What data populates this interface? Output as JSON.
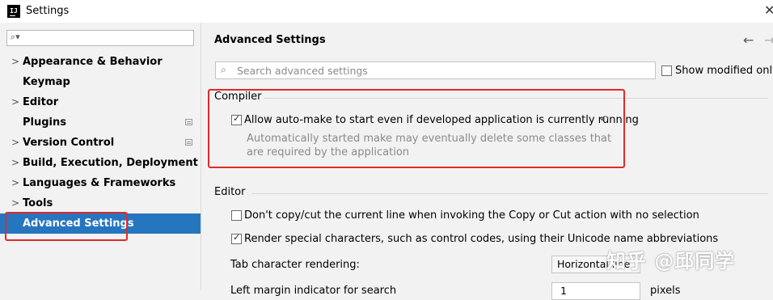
{
  "window": {
    "title": "Settings"
  },
  "sidebar": {
    "search_placeholder": "",
    "items": [
      {
        "label": "Appearance & Behavior",
        "chevron": true,
        "page_icon": false
      },
      {
        "label": "Keymap",
        "chevron": false,
        "page_icon": false
      },
      {
        "label": "Editor",
        "chevron": true,
        "page_icon": false
      },
      {
        "label": "Plugins",
        "chevron": false,
        "page_icon": true
      },
      {
        "label": "Version Control",
        "chevron": true,
        "page_icon": true
      },
      {
        "label": "Build, Execution, Deployment",
        "chevron": true,
        "page_icon": false
      },
      {
        "label": "Languages & Frameworks",
        "chevron": true,
        "page_icon": false
      },
      {
        "label": "Tools",
        "chevron": true,
        "page_icon": false
      },
      {
        "label": "Advanced Settings",
        "chevron": false,
        "page_icon": false,
        "selected": true
      }
    ]
  },
  "main": {
    "heading": "Advanced Settings",
    "search": {
      "placeholder": "Search advanced settings",
      "value": ""
    },
    "show_modified_only": {
      "label": "Show modified only",
      "checked": false
    },
    "compiler": {
      "title": "Compiler",
      "auto_make": {
        "label": "Allow auto-make to start even if developed application is currently running",
        "checked": true,
        "desc_line1": "Automatically started make may eventually delete some classes that",
        "desc_line2": "are required by the application"
      }
    },
    "editor": {
      "title": "Editor",
      "no_copy_cut": {
        "label": "Don't copy/cut the current line when invoking the Copy or Cut action with no selection",
        "checked": false
      },
      "render_special": {
        "label": "Render special characters, such as control codes, using their Unicode name abbreviations",
        "checked": true
      },
      "tab_rendering": {
        "label": "Tab character rendering:",
        "value": "Horizontal line"
      },
      "left_margin": {
        "label": "Left margin indicator for search",
        "value": "1",
        "unit": "pixels"
      }
    }
  },
  "watermark": "知乎 @邱同学",
  "colors": {
    "selection": "#2675bf",
    "annotation_red": "#e02a2a"
  }
}
